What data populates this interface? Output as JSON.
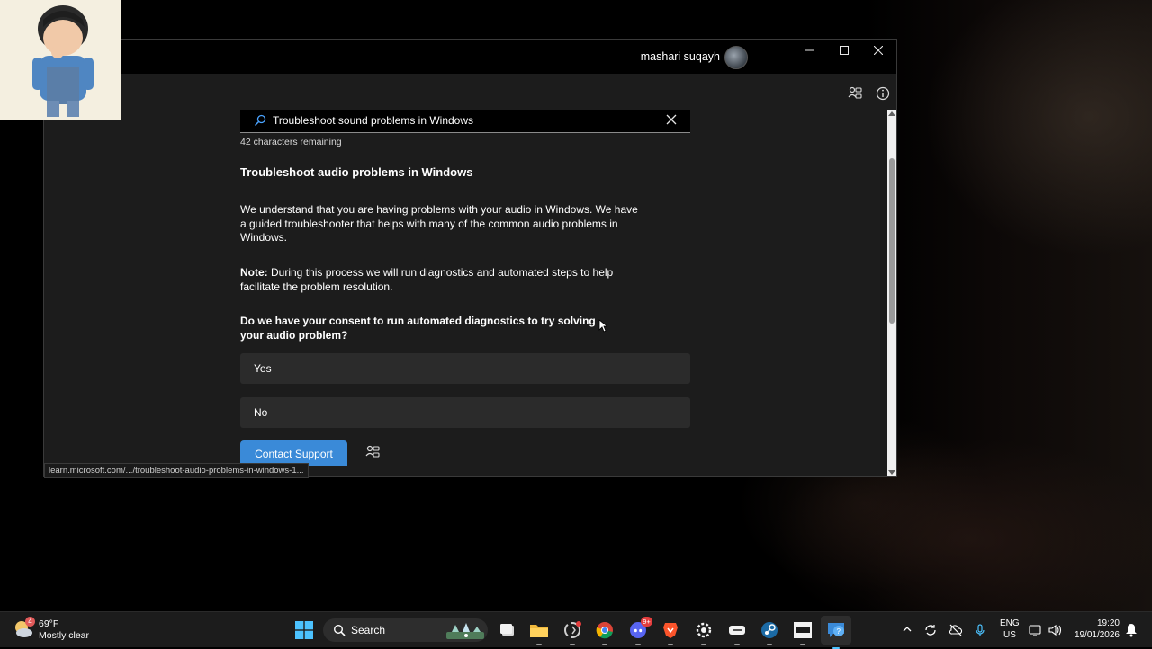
{
  "window": {
    "user_name": "mashari suqayh",
    "controls": {
      "minimize": "—",
      "maximize": "☐",
      "close": "✕"
    }
  },
  "search": {
    "query": "Troubleshoot sound problems in Windows",
    "chars_remaining": "42 characters remaining",
    "icon": "search-icon",
    "clear_icon": "close-icon"
  },
  "article": {
    "title": "Troubleshoot audio problems in Windows",
    "paragraph_1": "We understand that you are having problems with your audio in Windows. We have a guided troubleshooter that helps with many of the common audio problems in Windows.",
    "note_label": "Note:",
    "note_text": " During this process we will run diagnostics and automated steps to help facilitate the problem resolution.",
    "question": "Do we have your consent to run automated diagnostics to try solving your audio problem?",
    "choices": [
      "Yes",
      "No"
    ],
    "contact_support": "Contact Support"
  },
  "status_bar": {
    "url": "learn.microsoft.com/.../troubleshoot-audio-problems-in-windows-1..."
  },
  "taskbar": {
    "weather": {
      "badge": "4",
      "temp": "69°F",
      "desc": "Mostly clear"
    },
    "search_label": "Search",
    "badges": {
      "discord": "9+"
    },
    "language": {
      "line1": "ENG",
      "line2": "US"
    },
    "clock": {
      "time": "19:20",
      "date": "19/01/2026"
    }
  },
  "colors": {
    "accent": "#3a8ad8",
    "window_bg": "#1c1c1c",
    "choice_bg": "#2b2b2b",
    "taskbar_bg": "#1c1c1c"
  }
}
